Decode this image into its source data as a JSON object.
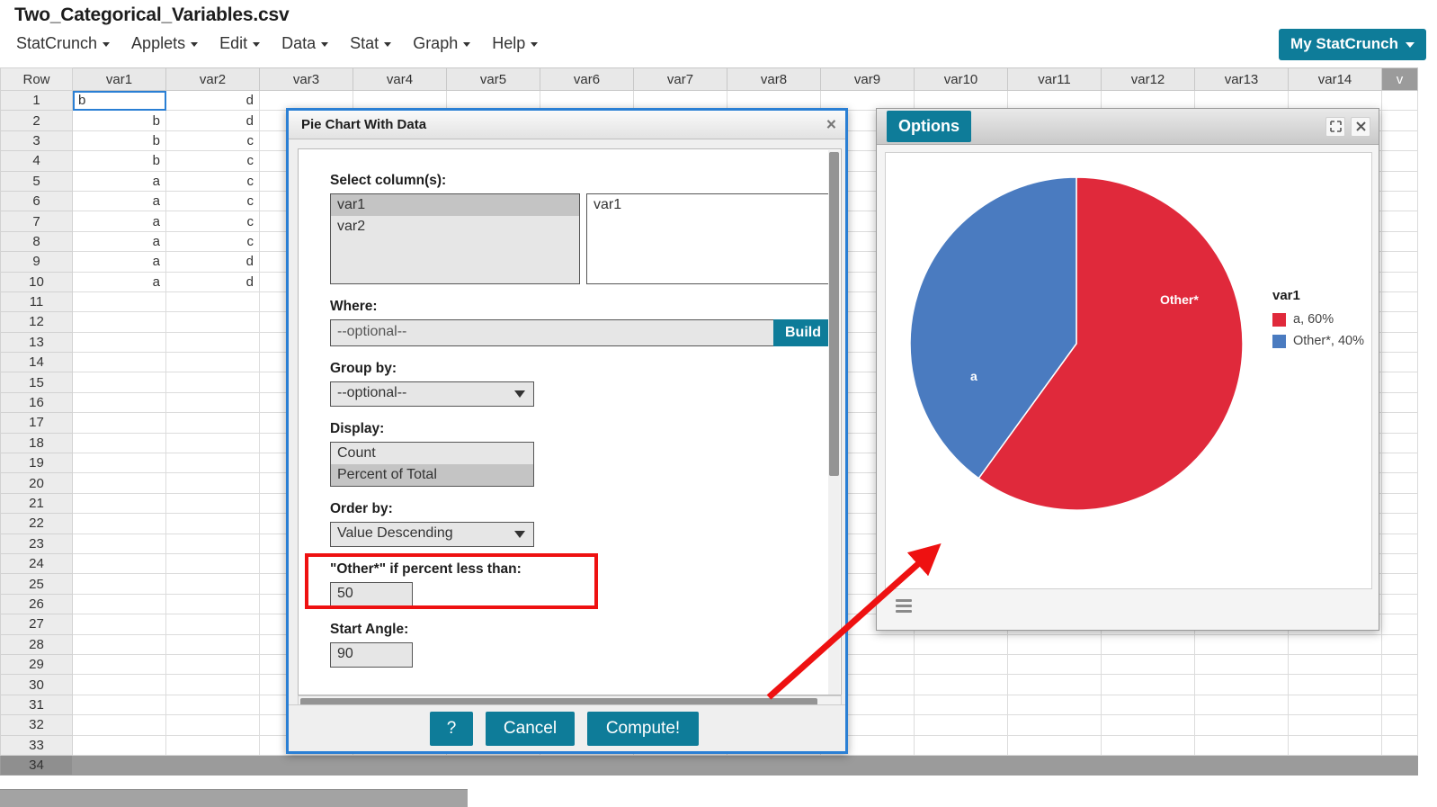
{
  "app": {
    "document_title": "Two_Categorical_Variables.csv",
    "menus": [
      "StatCrunch",
      "Applets",
      "Edit",
      "Data",
      "Stat",
      "Graph",
      "Help"
    ],
    "account_button": "My StatCrunch"
  },
  "spreadsheet": {
    "row_header": "Row",
    "columns": [
      "var1",
      "var2",
      "var3",
      "var4",
      "var5",
      "var6",
      "var7",
      "var8",
      "var9",
      "var10",
      "var11",
      "var12",
      "var13",
      "var14",
      "v"
    ],
    "rows": [
      {
        "n": "1",
        "var1": "b",
        "var2": "d"
      },
      {
        "n": "2",
        "var1": "b",
        "var2": "d"
      },
      {
        "n": "3",
        "var1": "b",
        "var2": "c"
      },
      {
        "n": "4",
        "var1": "b",
        "var2": "c"
      },
      {
        "n": "5",
        "var1": "a",
        "var2": "c"
      },
      {
        "n": "6",
        "var1": "a",
        "var2": "c"
      },
      {
        "n": "7",
        "var1": "a",
        "var2": "c"
      },
      {
        "n": "8",
        "var1": "a",
        "var2": "c"
      },
      {
        "n": "9",
        "var1": "a",
        "var2": "d"
      },
      {
        "n": "10",
        "var1": "a",
        "var2": "d"
      },
      {
        "n": "11",
        "var1": "",
        "var2": ""
      },
      {
        "n": "12",
        "var1": "",
        "var2": ""
      },
      {
        "n": "13",
        "var1": "",
        "var2": ""
      },
      {
        "n": "14",
        "var1": "",
        "var2": ""
      },
      {
        "n": "15",
        "var1": "",
        "var2": ""
      },
      {
        "n": "16",
        "var1": "",
        "var2": ""
      },
      {
        "n": "17",
        "var1": "",
        "var2": ""
      },
      {
        "n": "18",
        "var1": "",
        "var2": ""
      },
      {
        "n": "19",
        "var1": "",
        "var2": ""
      },
      {
        "n": "20",
        "var1": "",
        "var2": ""
      },
      {
        "n": "21",
        "var1": "",
        "var2": ""
      },
      {
        "n": "22",
        "var1": "",
        "var2": ""
      },
      {
        "n": "23",
        "var1": "",
        "var2": ""
      },
      {
        "n": "24",
        "var1": "",
        "var2": ""
      },
      {
        "n": "25",
        "var1": "",
        "var2": ""
      },
      {
        "n": "26",
        "var1": "",
        "var2": ""
      },
      {
        "n": "27",
        "var1": "",
        "var2": ""
      },
      {
        "n": "28",
        "var1": "",
        "var2": ""
      },
      {
        "n": "29",
        "var1": "",
        "var2": ""
      },
      {
        "n": "30",
        "var1": "",
        "var2": ""
      },
      {
        "n": "31",
        "var1": "",
        "var2": ""
      },
      {
        "n": "32",
        "var1": "",
        "var2": ""
      },
      {
        "n": "33",
        "var1": "",
        "var2": ""
      },
      {
        "n": "34",
        "var1": "",
        "var2": ""
      }
    ],
    "selected_cell": {
      "row": "1",
      "column": "var1",
      "value": "b"
    }
  },
  "dialog": {
    "title": "Pie Chart With Data",
    "close_icon": "×",
    "select_columns_label": "Select column(s):",
    "available_columns": [
      "var1",
      "var2"
    ],
    "available_selected": "var1",
    "chosen_columns": [
      "var1"
    ],
    "where_label": "Where:",
    "where_value": "--optional--",
    "build_label": "Build",
    "group_by_label": "Group by:",
    "group_by_value": "--optional--",
    "display_label": "Display:",
    "display_options": [
      "Count",
      "Percent of Total"
    ],
    "display_selected": "Percent of Total",
    "order_by_label": "Order by:",
    "order_by_value": "Value Descending",
    "other_label": "\"Other*\" if percent less than:",
    "other_value": "50",
    "start_angle_label": "Start Angle:",
    "start_angle_value": "90",
    "help_label": "?",
    "cancel_label": "Cancel",
    "compute_label": "Compute!",
    "highlight_color": "#ee1111"
  },
  "chart_window": {
    "options_label": "Options",
    "expand_icon": "expand-icon",
    "close_icon": "✖",
    "menu_icon": "hamburger-icon"
  },
  "chart_data": {
    "type": "pie",
    "title": "",
    "legend_title": "var1",
    "legend_position": "right",
    "start_angle": 90,
    "direction": "counterclockwise",
    "categories": [
      "a",
      "Other*"
    ],
    "values": [
      60,
      40
    ],
    "value_unit": "percent",
    "colors": [
      "#E0293B",
      "#4A7BC0"
    ],
    "slice_labels": [
      "a",
      "Other*"
    ],
    "legend_entries": [
      "a, 60%",
      "Other*, 40%"
    ]
  }
}
